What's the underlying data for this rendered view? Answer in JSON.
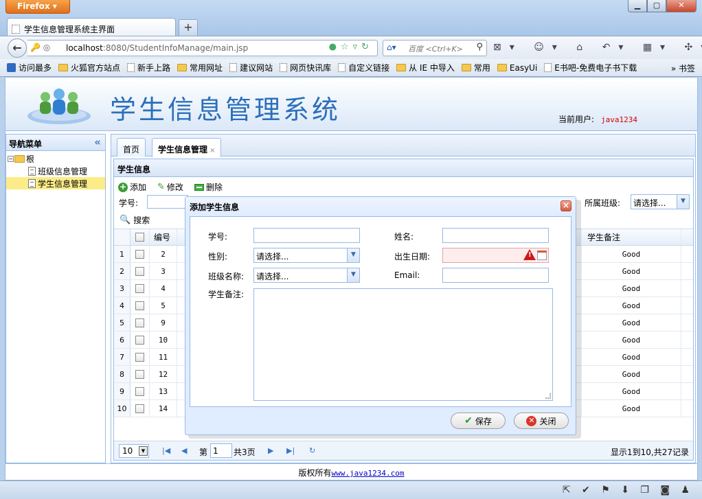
{
  "browser": {
    "app_button": "Firefox",
    "tab_title": "学生信息管理系统主界面",
    "new_tab": "+",
    "url_host": "localhost",
    "url_path": ":8080/StudentInfoManage/main.jsp",
    "search_placeholder": "百度 <Ctrl+K>",
    "bookmarks": [
      "访问最多",
      "火狐官方站点",
      "新手上路",
      "常用网址",
      "建议网站",
      "网页快讯库",
      "自定义链接",
      "从 IE 中导入",
      "常用",
      "EasyUi",
      "E书吧-免费电子书下载"
    ],
    "bookmarks_more": "» 书签"
  },
  "app": {
    "title": "学生信息管理系统",
    "current_user_label": "当前用户:",
    "current_user": "java1234"
  },
  "nav": {
    "title": "导航菜单",
    "collapse_glyph": "«",
    "root": "根",
    "items": [
      "班级信息管理",
      "学生信息管理"
    ]
  },
  "tabs": [
    {
      "label": "首页"
    },
    {
      "label": "学生信息管理",
      "close": "×"
    }
  ],
  "panel": {
    "title": "学生信息",
    "toolbar": {
      "add": "添加",
      "edit": "修改",
      "delete": "删除"
    },
    "search": {
      "id_label": "学号:",
      "class_label": "所属班级:",
      "class_value": "请选择...",
      "button": "搜索"
    }
  },
  "grid": {
    "columns": {
      "id": "编号",
      "note": "学生备注"
    },
    "rows": [
      {
        "rn": "1",
        "id": "2",
        "note": "Good"
      },
      {
        "rn": "2",
        "id": "3",
        "note": "Good"
      },
      {
        "rn": "3",
        "id": "4",
        "note": "Good"
      },
      {
        "rn": "4",
        "id": "5",
        "note": "Good"
      },
      {
        "rn": "5",
        "id": "9",
        "note": "Good"
      },
      {
        "rn": "6",
        "id": "10",
        "note": "Good"
      },
      {
        "rn": "7",
        "id": "11",
        "note": "Good"
      },
      {
        "rn": "8",
        "id": "12",
        "note": "Good"
      },
      {
        "rn": "9",
        "id": "13",
        "note": "Good"
      },
      {
        "rn": "10",
        "id": "14",
        "note": "Good"
      }
    ]
  },
  "pager": {
    "page_size": "10",
    "page_prefix": "第",
    "page_value": "1",
    "page_suffix": "共3页",
    "summary": "显示1到10,共27记录"
  },
  "footer": {
    "text": "版权所有",
    "link": "www.java1234.com"
  },
  "dialog": {
    "title": "添加学生信息",
    "close": "×",
    "fields": {
      "stu_no_label": "学号:",
      "name_label": "姓名:",
      "sex_label": "性别:",
      "sex_value": "请选择...",
      "birthday_label": "出生日期:",
      "class_label": "班级名称:",
      "class_value": "请选择...",
      "email_label": "Email:",
      "note_label": "学生备注:"
    },
    "buttons": {
      "save": "保存",
      "close": "关闭"
    }
  }
}
